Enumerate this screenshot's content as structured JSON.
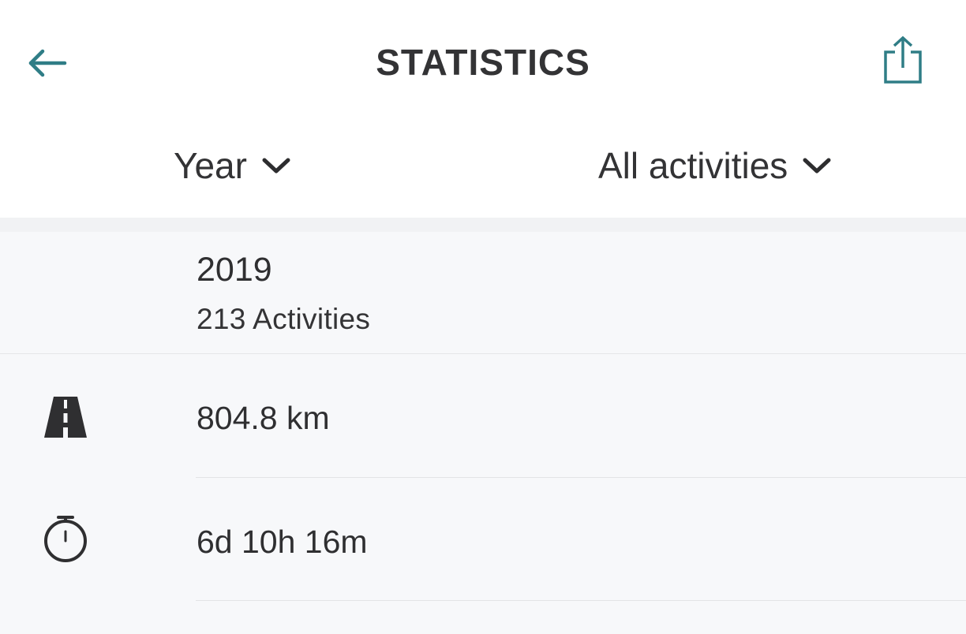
{
  "header": {
    "title": "STATISTICS",
    "back_icon": "arrow-left-icon",
    "share_icon": "share-icon",
    "accent_color": "#2f7d86"
  },
  "filters": {
    "period": "Year",
    "activity_type": "All activities"
  },
  "summary": {
    "year": "2019",
    "activities": "213 Activities"
  },
  "stats": {
    "distance": {
      "icon": "road-icon",
      "value": "804.8 km"
    },
    "duration": {
      "icon": "stopwatch-icon",
      "value": "6d 10h 16m"
    }
  }
}
